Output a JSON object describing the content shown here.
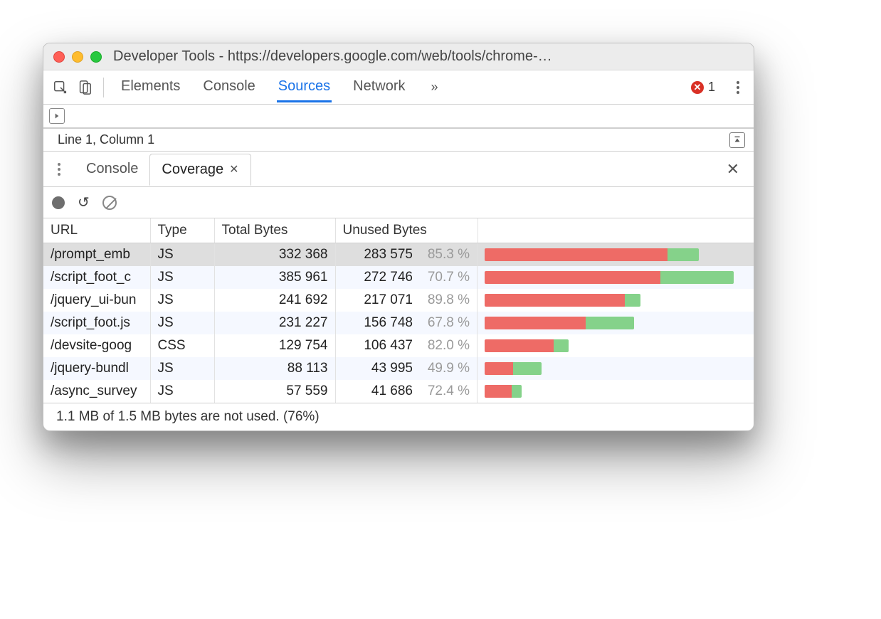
{
  "window": {
    "title": "Developer Tools - https://developers.google.com/web/tools/chrome-…"
  },
  "toolbar": {
    "tabs": [
      "Elements",
      "Console",
      "Sources",
      "Network"
    ],
    "active_tab": "Sources",
    "more_indicator": "»",
    "error_count": "1"
  },
  "source_status": {
    "cursor": "Line 1, Column 1"
  },
  "drawer": {
    "tabs": [
      "Console",
      "Coverage"
    ],
    "active_tab": "Coverage"
  },
  "coverage": {
    "headers": {
      "url": "URL",
      "type": "Type",
      "total": "Total Bytes",
      "unused": "Unused Bytes"
    },
    "max_bytes": 385961,
    "rows": [
      {
        "url": "/prompt_emb",
        "type": "JS",
        "total": "332 368",
        "unused": "283 575",
        "pct": "85.3 %",
        "total_n": 332368,
        "unused_n": 283575,
        "selected": true
      },
      {
        "url": "/script_foot_c",
        "type": "JS",
        "total": "385 961",
        "unused": "272 746",
        "pct": "70.7 %",
        "total_n": 385961,
        "unused_n": 272746
      },
      {
        "url": "/jquery_ui-bun",
        "type": "JS",
        "total": "241 692",
        "unused": "217 071",
        "pct": "89.8 %",
        "total_n": 241692,
        "unused_n": 217071
      },
      {
        "url": "/script_foot.js",
        "type": "JS",
        "total": "231 227",
        "unused": "156 748",
        "pct": "67.8 %",
        "total_n": 231227,
        "unused_n": 156748
      },
      {
        "url": "/devsite-goog",
        "type": "CSS",
        "total": "129 754",
        "unused": "106 437",
        "pct": "82.0 %",
        "total_n": 129754,
        "unused_n": 106437
      },
      {
        "url": "/jquery-bundl",
        "type": "JS",
        "total": "88 113",
        "unused": "43 995",
        "pct": "49.9 %",
        "total_n": 88113,
        "unused_n": 43995
      },
      {
        "url": "/async_survey",
        "type": "JS",
        "total": "57 559",
        "unused": "41 686",
        "pct": "72.4 %",
        "total_n": 57559,
        "unused_n": 41686
      }
    ],
    "footer": "1.1 MB of 1.5 MB bytes are not used. (76%)"
  }
}
